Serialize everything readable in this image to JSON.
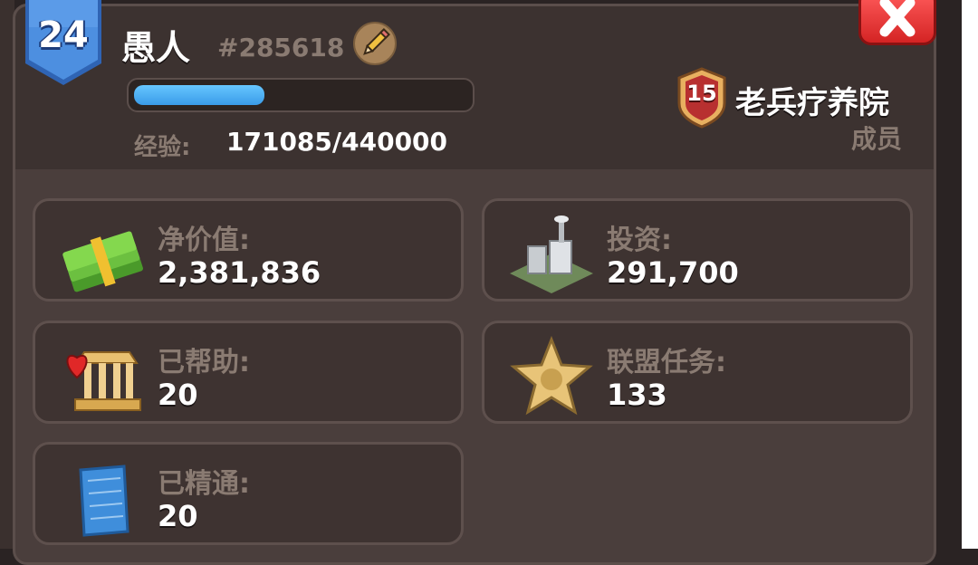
{
  "player": {
    "level": "24",
    "name": "愚人",
    "id": "#285618",
    "xp_label": "经验:",
    "xp_value": "171085/440000",
    "xp_progress": 0.39
  },
  "alliance": {
    "level": "15",
    "name": "老兵疗养院",
    "role": "成员"
  },
  "stats": [
    {
      "label": "净价值:",
      "value": "2,381,836",
      "icon": "money-stack-icon"
    },
    {
      "label": "投资:",
      "value": "291,700",
      "icon": "factory-building-icon"
    },
    {
      "label": "已帮助:",
      "value": "20",
      "icon": "charity-building-heart-icon"
    },
    {
      "label": "联盟任务:",
      "value": "133",
      "icon": "sheriff-star-icon"
    },
    {
      "label": "已精通:",
      "value": "20",
      "icon": "blueprint-icon"
    }
  ],
  "colors": {
    "panel": "#4a3e3c",
    "header": "#3c3230",
    "card": "#3e3331",
    "muted_text": "#8a7b72",
    "xp_blue": "#4aa8f0",
    "close_red": "#e83a3a",
    "level_blue": "#3e7fd6"
  }
}
